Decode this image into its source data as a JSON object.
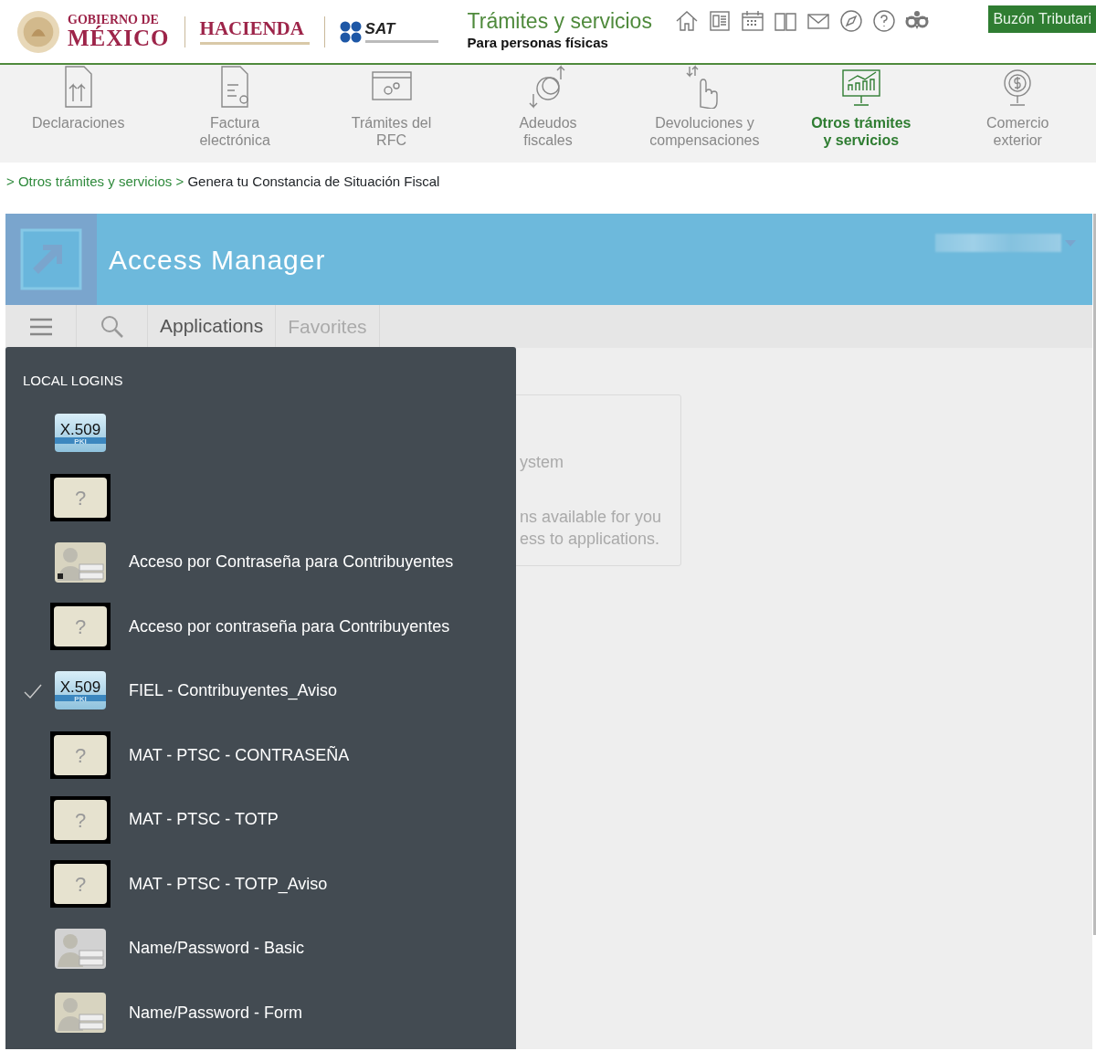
{
  "header": {
    "logos": {
      "gobierno": [
        "GOBIERNO DE",
        "MÉXICO"
      ],
      "hacienda": {
        "title": "HACIENDA"
      },
      "sat": {
        "title": "SAT"
      }
    },
    "site_title": "Trámites y servicios",
    "site_subtitle": "Para personas físicas",
    "mailbox_button": "Buzón Tributari"
  },
  "nav": [
    {
      "label": [
        "Declaraciones"
      ],
      "selected": false
    },
    {
      "label": [
        "Factura",
        "electrónica"
      ],
      "selected": false
    },
    {
      "label": [
        "Trámites del",
        "RFC"
      ],
      "selected": false
    },
    {
      "label": [
        "Adeudos",
        "fiscales"
      ],
      "selected": false
    },
    {
      "label": [
        "Devoluciones y",
        "compensaciones"
      ],
      "selected": false
    },
    {
      "label": [
        "Otros trámites",
        "y servicios"
      ],
      "selected": true
    },
    {
      "label": [
        "Comercio",
        "exterior"
      ],
      "selected": false
    }
  ],
  "breadcrumb": [
    {
      "separator": ">",
      "label": "Otros trámites y servicios",
      "kind": "link"
    },
    {
      "separator": ">",
      "label": "Genera tu Constancia de Situación Fiscal",
      "kind": "current"
    }
  ],
  "access_manager": {
    "title": "Access Manager",
    "tabs": [
      {
        "label": "Applications",
        "selected": true
      },
      {
        "label": "Favorites",
        "selected": false
      }
    ],
    "background_card": [
      "ystem",
      "ns available for you",
      "ess to applications."
    ],
    "logins": {
      "heading": "LOCAL LOGINS",
      "items": [
        {
          "kind": "x509",
          "icon_text": "X.509",
          "icon_sub": "PKI",
          "checked": false
        },
        {
          "kind": "unknown",
          "icon_text": "?",
          "checked": false
        },
        {
          "kind": "password-lock",
          "label": "Acceso por Contraseña para Contribuyentes",
          "checked": false
        },
        {
          "kind": "unknown",
          "icon_text": "?",
          "label": "Acceso por contraseña para Contribuyentes",
          "checked": false
        },
        {
          "kind": "x509",
          "icon_text": "X.509",
          "icon_sub": "PKI",
          "label": "FIEL - Contribuyentes_Aviso",
          "checked": true
        },
        {
          "kind": "unknown",
          "icon_text": "?",
          "label": "MAT - PTSC - CONTRASEÑA",
          "checked": false
        },
        {
          "kind": "unknown",
          "icon_text": "?",
          "label": "MAT - PTSC - TOTP",
          "checked": false
        },
        {
          "kind": "unknown",
          "icon_text": "?",
          "label": "MAT - PTSC - TOTP_Aviso",
          "checked": false
        },
        {
          "kind": "password-basic",
          "label": "Name/Password - Basic",
          "checked": false
        },
        {
          "kind": "password-form",
          "label": "Name/Password - Form",
          "checked": false
        }
      ]
    }
  }
}
